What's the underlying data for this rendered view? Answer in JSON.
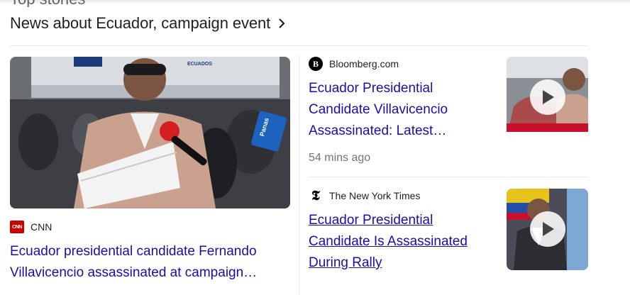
{
  "section": {
    "partial_heading": "Top stories",
    "title": "News about Ecuador, campaign event"
  },
  "main_story": {
    "source": "CNN",
    "title_line1": "Ecuador presidential candidate Fernando",
    "title_line2": "Villavicencio assassinated at campaign…",
    "image_sign_text": "ECUADOS",
    "mic_label": "Panas"
  },
  "stories": [
    {
      "source": "Bloomberg.com",
      "title_line1": "Ecuador Presidential",
      "title_line2": "Candidate Villavicencio",
      "title_line3": "Assassinated: Latest…",
      "time": "54 mins ago"
    },
    {
      "source": "The New York Times",
      "title_line1": "Ecuador Presidential",
      "title_line2": "Candidate Is Assassinated",
      "title_line3": "During Rally"
    }
  ],
  "colors": {
    "link": "#1a0dab",
    "meta": "#70757a",
    "cnn_red": "#cc0000"
  },
  "icons": [
    "chevron-right-icon",
    "cnn-logo-icon",
    "bloomberg-logo-icon",
    "nyt-logo-icon",
    "play-icon"
  ]
}
